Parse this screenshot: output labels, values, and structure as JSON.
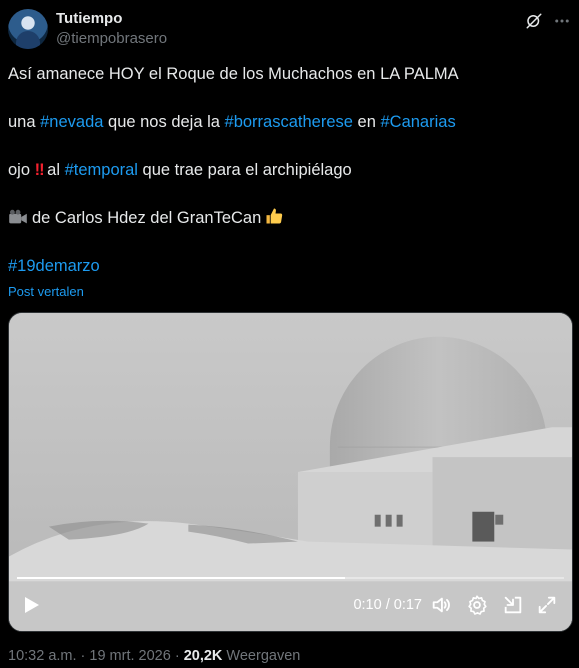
{
  "author": {
    "name": "Tutiempo",
    "handle": "@tiempobrasero"
  },
  "tweet": {
    "line1": "Así amanece  HOY el Roque de los Muchachos en LA PALMA",
    "line2_a": "una ",
    "line2_tag1": "#nevada",
    "line2_b": " que nos deja la ",
    "line2_tag2": "#borrascatherese",
    "line2_c": " en ",
    "line2_tag3": "#Canarias",
    "line3_a": "ojo ",
    "line3_bang": "‼",
    "line3_b": " al ",
    "line3_tag": "#temporal",
    "line3_c": " que trae para el archipiélago",
    "line4": "de Carlos Hdez del GranTeCan",
    "line5_tag": "#19demarzo"
  },
  "translate_link": "Post vertalen",
  "video": {
    "time": "0:10 / 0:17",
    "progress": 0.6
  },
  "footer": {
    "time_date": "10:32 a.m. · 19 mrt. 2026 · ",
    "views_count": "20,2K",
    "views_label": " Weergaven"
  },
  "icons": {
    "grok": "grok-icon",
    "more": "more-icon",
    "play": "play-icon",
    "volume": "volume-icon",
    "settings": "settings-icon",
    "dock": "dock-icon",
    "fullscreen": "fullscreen-icon"
  },
  "colors": {
    "accent": "#1d9bf0",
    "text": "#e7e9ea",
    "muted": "#71767b",
    "background": "#000000"
  }
}
